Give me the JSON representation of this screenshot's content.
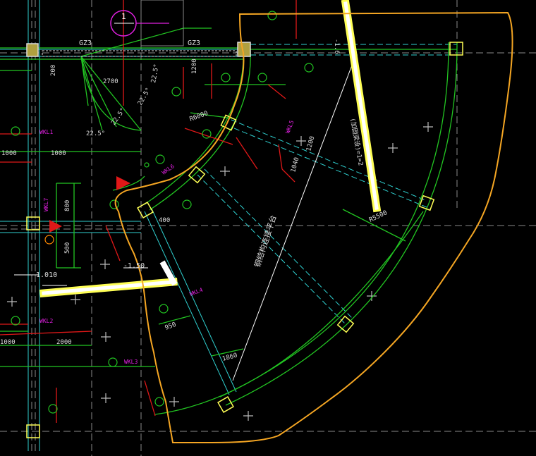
{
  "drawing": {
    "labels": {
      "gz3_left": "GZ3",
      "gz3_right": "GZ3",
      "axis_1": "1",
      "ang_1": "22.5°",
      "ang_2": "22.5°",
      "ang_3": "22.5°",
      "ang_4": "22.5°",
      "dim_200": "200",
      "dim_2700": "2700",
      "dim_1000_a": "1000",
      "dim_1000_b": "1000",
      "dim_1000_c": "1000",
      "dim_2000": "2000",
      "dim_1200": "1200",
      "dim_800": "800",
      "dim_500": "500",
      "dim_400": "400",
      "dim_950": "950",
      "dim_1860": "1860",
      "dim_1200b": "1200",
      "dim_1040": "1040",
      "dim_3000": "R6000",
      "r5500": "R5500",
      "level_left": "-1.010",
      "level_mid": "-1.50",
      "level_arc": "-1.6",
      "beam_text": "(加固梁设)=1=2",
      "center_text": "钢结构连接平台"
    },
    "magenta_tags": [
      "WKL1",
      "WKL2",
      "WKL3",
      "WKL4",
      "WKL5",
      "WKL6",
      "WKL7"
    ],
    "colors": {
      "background": "#000000",
      "cloud": "#f5a623",
      "green": "#22c522",
      "cyan": "#2fd0d0",
      "red": "#e01818",
      "magenta": "#e020e0",
      "yellow": "#ffff55",
      "white": "#ffffff",
      "grid": "#8a8a8a"
    }
  }
}
